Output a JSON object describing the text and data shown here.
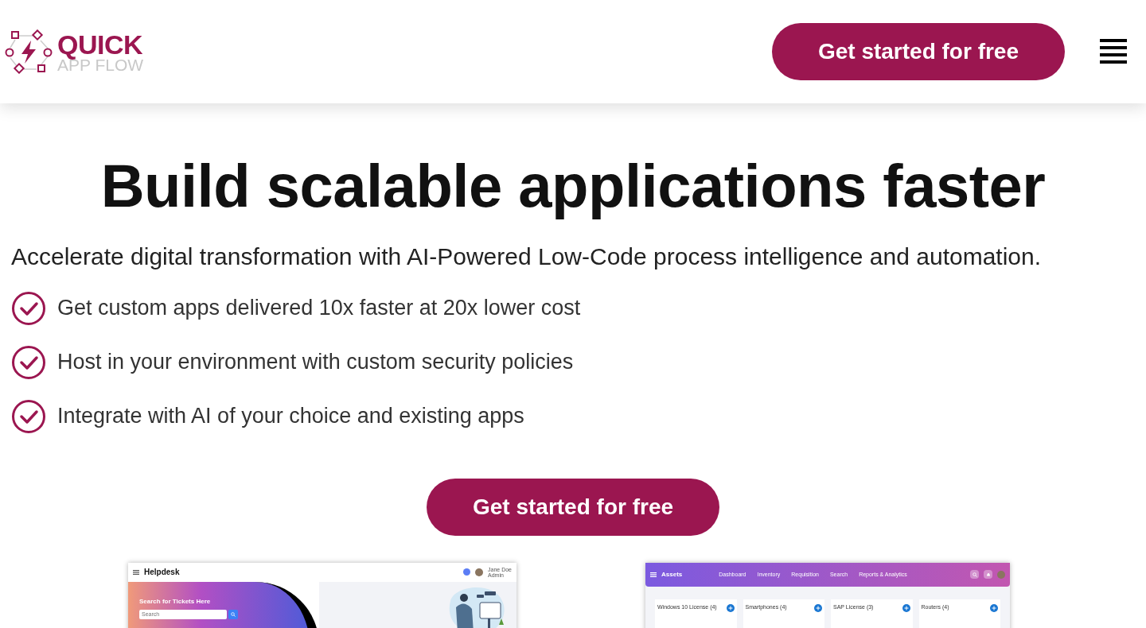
{
  "header": {
    "logo_title": "QUICK",
    "logo_subtitle": "APP FLOW",
    "cta": "Get started for free"
  },
  "hero": {
    "headline": "Build scalable applications faster",
    "subtitle": "Accelerate digital transformation with AI-Powered Low-Code process intelligence and automation.",
    "features": [
      "Get custom apps delivered 10x faster at 20x lower cost",
      "Host in your environment with custom security policies",
      "Integrate with AI of your choice and existing apps"
    ],
    "cta": "Get started for free"
  },
  "helpdesk_preview": {
    "title": "Helpdesk",
    "user_name": "Jane Doe",
    "user_role": "Admin",
    "search_heading": "Search for Tickets Here",
    "search_placeholder": "Search"
  },
  "assets_preview": {
    "title": "Assets",
    "nav": [
      "Dashboard",
      "Inventory",
      "Requisition",
      "Search",
      "Reports & Analytics"
    ],
    "cards": [
      "Windows 10 License (4)",
      "Smartphones (4)",
      "SAP License (3)",
      "Routers (4)"
    ]
  }
}
